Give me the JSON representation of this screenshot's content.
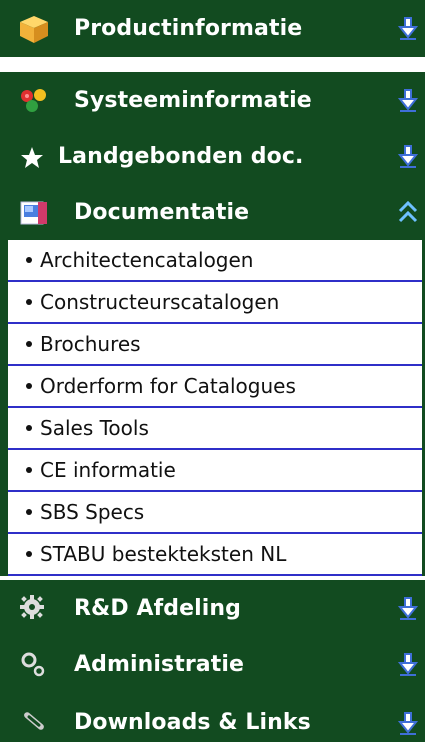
{
  "menu": {
    "sections": [
      {
        "label": "Productinformatie",
        "icon": "box-icon",
        "expanded": false
      },
      {
        "label": "Systeeminformatie",
        "icon": "hearts-icon",
        "expanded": false
      },
      {
        "label": "Landgebonden doc.",
        "icon": "star-icon",
        "expanded": false
      },
      {
        "label": "Documentatie",
        "icon": "book-icon",
        "expanded": true
      },
      {
        "label": "R&D Afdeling",
        "icon": "gear-icon",
        "expanded": false
      },
      {
        "label": "Administratie",
        "icon": "gears-icon",
        "expanded": false
      },
      {
        "label": "Downloads & Links",
        "icon": "paperclip-icon",
        "expanded": false
      }
    ],
    "documentatie_items": [
      "Architectencatalogen",
      "Constructeurscatalogen",
      "Brochures",
      "Orderform for Catalogues",
      "Sales Tools",
      "CE informatie",
      "SBS Specs",
      "STABU bestekteksten NL"
    ]
  },
  "colors": {
    "header_bg": "#124b20",
    "header_text": "#ffffff",
    "arrow": "#3f6fd8",
    "divider": "#2f2fc8"
  }
}
